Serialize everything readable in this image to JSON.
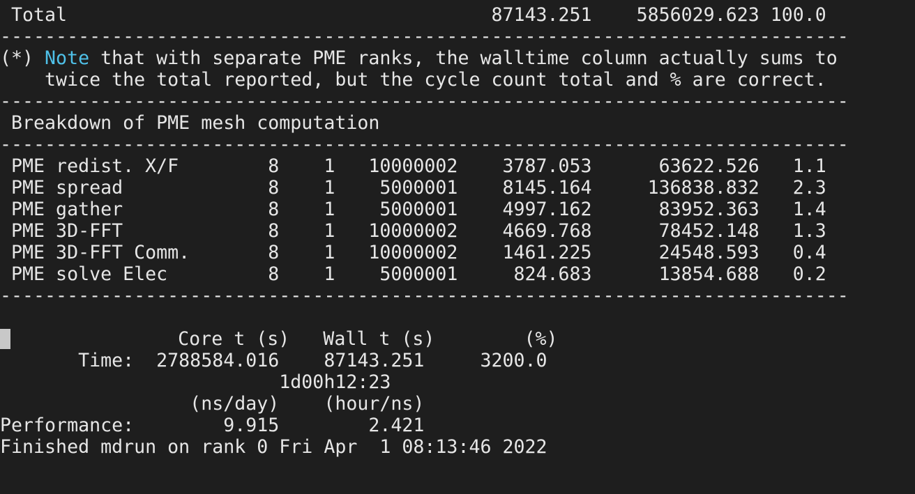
{
  "terminal": {
    "total_line": " Total                                      87143.251    5856029.623 100.0",
    "divider": "----------------------------------------------------------------------------",
    "note_prefix": "(*) ",
    "note_keyword": "Note",
    "note_rest": " that with separate PME ranks, the walltime column actually sums to",
    "note_line2": "    twice the total reported, but the cycle count total and % are correct.",
    "breakdown_title": " Breakdown of PME mesh computation",
    "pme_rows": [
      " PME redist. X/F        8    1   10000002    3787.053      63622.526   1.1",
      " PME spread             8    1    5000001    8145.164     136838.832   2.3",
      " PME gather             8    1    5000001    4997.162      83952.363   1.4",
      " PME 3D-FFT             8    1   10000002    4669.768      78452.148   1.3",
      " PME 3D-FFT Comm.       8    1   10000002    1461.225      24548.593   0.4",
      " PME solve Elec         8    1    5000001     824.683      13854.688   0.2"
    ],
    "time_header": "               Core t (s)   Wall t (s)        (%)",
    "time_line": "       Time:  2788584.016    87143.251     3200.0",
    "elapsed_line": "                         1d00h12:23",
    "perf_header": "                 (ns/day)    (hour/ns)",
    "perf_line": "Performance:        9.915        2.421",
    "finished_line": "Finished mdrun on rank 0 Fri Apr  1 08:13:46 2022"
  }
}
